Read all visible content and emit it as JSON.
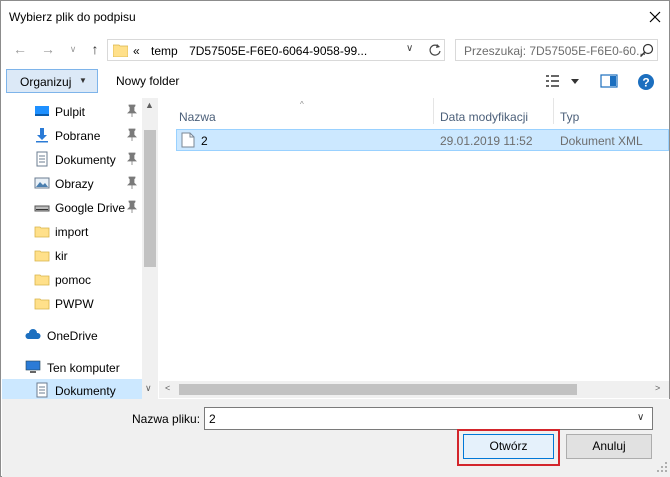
{
  "window": {
    "title": "Wybierz plik do podpisu"
  },
  "address": {
    "overflow": "«",
    "crumbs": [
      "temp",
      "7D57505E-F6E0-6064-9058-99..."
    ]
  },
  "search": {
    "placeholder": "Przeszukaj: 7D57505E-F6E0-60..."
  },
  "toolbar": {
    "organize_label": "Organizuj",
    "new_folder_label": "Nowy folder"
  },
  "nav": {
    "items": [
      {
        "label": "Pulpit",
        "icon": "desktop-icon",
        "pinned": true
      },
      {
        "label": "Pobrane",
        "icon": "download-icon",
        "pinned": true
      },
      {
        "label": "Dokumenty",
        "icon": "documents-icon",
        "pinned": true
      },
      {
        "label": "Obrazy",
        "icon": "pictures-icon",
        "pinned": true
      },
      {
        "label": "Google Drive",
        "icon": "drive-icon",
        "pinned": true
      },
      {
        "label": "import",
        "icon": "folder-icon",
        "pinned": false
      },
      {
        "label": "kir",
        "icon": "folder-icon",
        "pinned": false
      },
      {
        "label": "pomoc",
        "icon": "folder-icon",
        "pinned": false
      },
      {
        "label": "PWPW",
        "icon": "folder-icon",
        "pinned": false
      },
      {
        "label": "OneDrive",
        "icon": "cloud-icon",
        "pinned": false
      },
      {
        "label": "Ten komputer",
        "icon": "computer-icon",
        "pinned": false
      },
      {
        "label": "Dokumenty",
        "icon": "documents-icon",
        "pinned": false,
        "selected": true
      }
    ]
  },
  "files": {
    "columns": [
      "Nazwa",
      "Data modyfikacji",
      "Typ"
    ],
    "rows": [
      {
        "name": "2",
        "modified": "29.01.2019 11:52",
        "type": "Dokument XML"
      }
    ]
  },
  "bottom": {
    "filename_label": "Nazwa pliku:",
    "filename_value": "2",
    "open_label": "Otwórz",
    "cancel_label": "Anuluj"
  },
  "colors": {
    "selection": "#cce8ff",
    "highlight_frame": "#d3252b",
    "accent": "#0078d7"
  }
}
